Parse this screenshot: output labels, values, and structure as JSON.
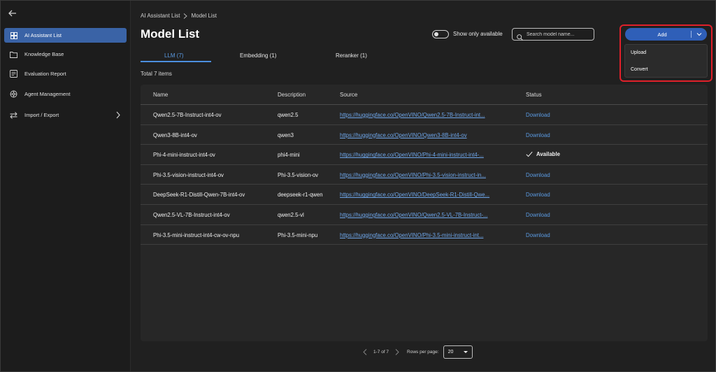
{
  "sidebar": {
    "items": [
      {
        "label": "AI Assistant List",
        "icon": "grid-icon",
        "active": true
      },
      {
        "label": "Knowledge Base",
        "icon": "folder-icon"
      },
      {
        "label": "Evaluation Report",
        "icon": "report-icon"
      },
      {
        "label": "Agent Management",
        "icon": "agent-icon"
      },
      {
        "label": "Import / Export",
        "icon": "import-export-icon",
        "expandable": true
      }
    ]
  },
  "breadcrumb": {
    "parent": "AI Assistant List",
    "current": "Model List"
  },
  "header": {
    "title": "Model List",
    "toggle_label": "Show only available",
    "toggle_on": false,
    "search_placeholder": "Search model name...",
    "add_label": "Add"
  },
  "add_menu": {
    "items": [
      "Upload",
      "Convert"
    ]
  },
  "tabs": [
    {
      "label": "LLM (7)",
      "active": true
    },
    {
      "label": "Embedding (1)",
      "active": false
    },
    {
      "label": "Reranker (1)",
      "active": false
    }
  ],
  "total_text": "Total 7 items",
  "table": {
    "columns": [
      "Name",
      "Description",
      "Source",
      "Status"
    ],
    "rows": [
      {
        "name": "Qwen2.5-7B-Instruct-int4-ov",
        "description": "qwen2.5",
        "source": "https://huggingface.co/OpenVINO/Qwen2.5-7B-Instruct-int...",
        "status": "Download"
      },
      {
        "name": "Qwen3-8B-int4-ov",
        "description": "qwen3",
        "source": "https://huggingface.co/OpenVINO/Qwen3-8B-int4-ov",
        "status": "Download"
      },
      {
        "name": "Phi-4-mini-instruct-int4-ov",
        "description": "phi4-mini",
        "source": "https://huggingface.co/OpenVINO/Phi-4-mini-instruct-int4-...",
        "status": "Available"
      },
      {
        "name": "Phi-3.5-vision-instruct-int4-ov",
        "description": "Phi-3.5-vision-ov",
        "source": "https://huggingface.co/OpenVINO/Phi-3.5-vision-instruct-in...",
        "status": "Download"
      },
      {
        "name": "DeepSeek-R1-Distill-Qwen-7B-int4-ov",
        "description": "deepseek-r1-qwen",
        "source": "https://huggingface.co/OpenVINO/DeepSeek-R1-Distill-Qwe...",
        "status": "Download"
      },
      {
        "name": "Qwen2.5-VL-7B-Instruct-int4-ov",
        "description": "qwen2.5-vl",
        "source": "https://huggingface.co/OpenVINO/Qwen2.5-VL-7B-Instruct-...",
        "status": "Download"
      },
      {
        "name": "Phi-3.5-mini-instruct-int4-cw-ov-npu",
        "description": "Phi-3.5-mini-npu",
        "source": "https://huggingface.co/OpenVINO/Phi-3.5-mini-instruct-int...",
        "status": "Download"
      }
    ]
  },
  "pagination": {
    "range": "1-7 of 7",
    "rows_label": "Rows per page:",
    "rows_per_page": "20"
  },
  "colors": {
    "accent": "#2f5fb8",
    "link": "#6ea6ea",
    "highlight": "#e0202a",
    "background": "#202020"
  }
}
